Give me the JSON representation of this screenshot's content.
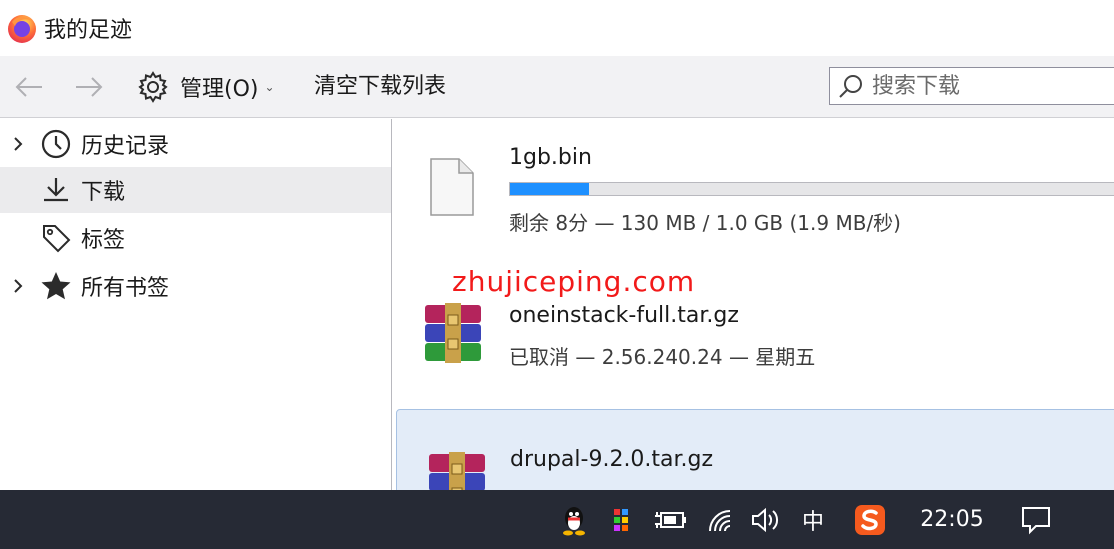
{
  "window": {
    "title": "我的足迹"
  },
  "toolbar": {
    "manage_label": "管理(O)",
    "clear_label": "清空下载列表",
    "search_placeholder": "搜索下载"
  },
  "sidebar": {
    "items": [
      {
        "label": "历史记录",
        "icon": "clock-icon",
        "expandable": true
      },
      {
        "label": "下载",
        "icon": "download-icon",
        "selected": true
      },
      {
        "label": "标签",
        "icon": "tag-icon"
      },
      {
        "label": "所有书签",
        "icon": "star-icon",
        "expandable": true
      }
    ]
  },
  "downloads": [
    {
      "name": "1gb.bin",
      "status": "剩余 8分 — 130 MB / 1.0 GB (1.9 MB/秒)",
      "progress": 0.13,
      "icon": "file-icon"
    },
    {
      "name": "oneinstack-full.tar.gz",
      "status": "已取消 — 2.56.240.24 — 星期五",
      "icon": "winrar-archive-icon"
    },
    {
      "name": "drupal-9.2.0.tar.gz",
      "status": "",
      "icon": "winrar-archive-icon"
    }
  ],
  "watermark": "zhujiceping.com",
  "taskbar": {
    "ime_label": "中",
    "clock": "22:05"
  },
  "colors": {
    "progress_fill": "#1e90ff",
    "taskbar_bg": "#262a35",
    "watermark": "#f21a1a"
  }
}
